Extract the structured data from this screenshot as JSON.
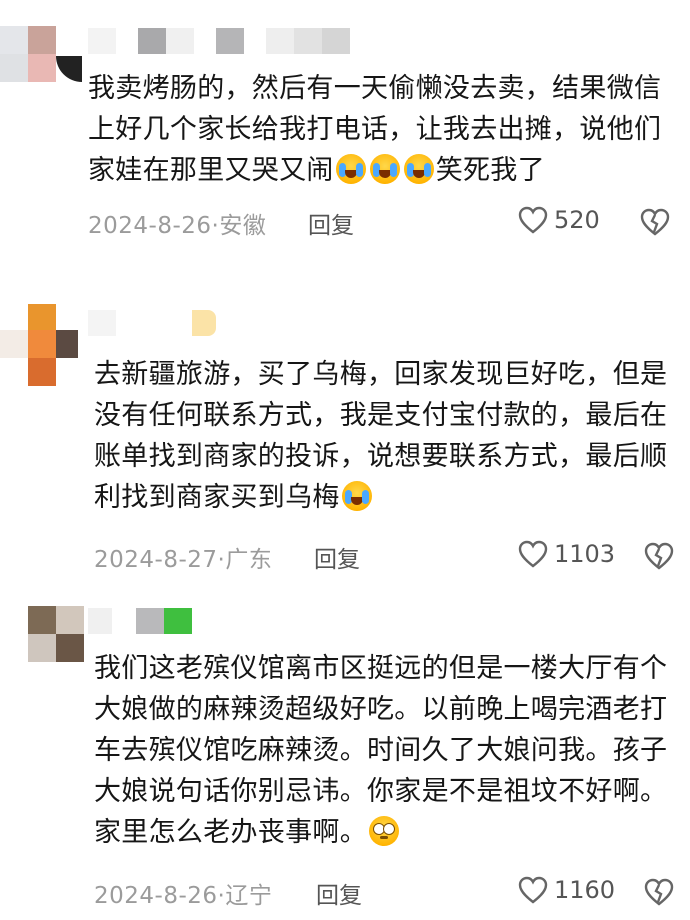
{
  "comments": [
    {
      "text_parts": [
        "我卖烤肠的，然后有一天偷懒没去卖，结果微信上好几个家长给我打电话，让我去出摊，说他们家娃在那里又哭又闹",
        "笑死我了"
      ],
      "emojis": [
        "loudly-crying-face",
        "loudly-crying-face",
        "loudly-crying-face"
      ],
      "date": "2024-8-26",
      "location": "安徽",
      "reply_label": "回复",
      "likes": "520"
    },
    {
      "text_parts": [
        "去新疆旅游，买了乌梅，回家发现巨好吃，但是没有任何联系方式，我是支付宝付款的，最后在账单找到商家的投诉，说想要联系方式，最后顺利找到商家买到乌梅"
      ],
      "emojis": [
        "loudly-crying-face"
      ],
      "date": "2024-8-27",
      "location": "广东",
      "reply_label": "回复",
      "likes": "1103"
    },
    {
      "text_parts": [
        "我们这老殡仪馆离市区挺远的但是一楼大厅有个大娘做的麻辣烫超级好吃。以前晚上喝完酒老打车去殡仪馆吃麻辣烫。时间久了大娘问我。孩子大娘说句话你别忌讳。你家是不是祖坟不好啊。家里怎么老办丧事啊。"
      ],
      "emojis": [
        "face-with-rolling-eyes"
      ],
      "date": "2024-8-26",
      "location": "辽宁",
      "reply_label": "回复",
      "likes": "1160"
    }
  ],
  "icons": {
    "like": "heart-outline-icon",
    "dislike": "broken-heart-icon"
  },
  "colors": {
    "meta_text": "#9b9b9b",
    "body_text": "#161616"
  }
}
